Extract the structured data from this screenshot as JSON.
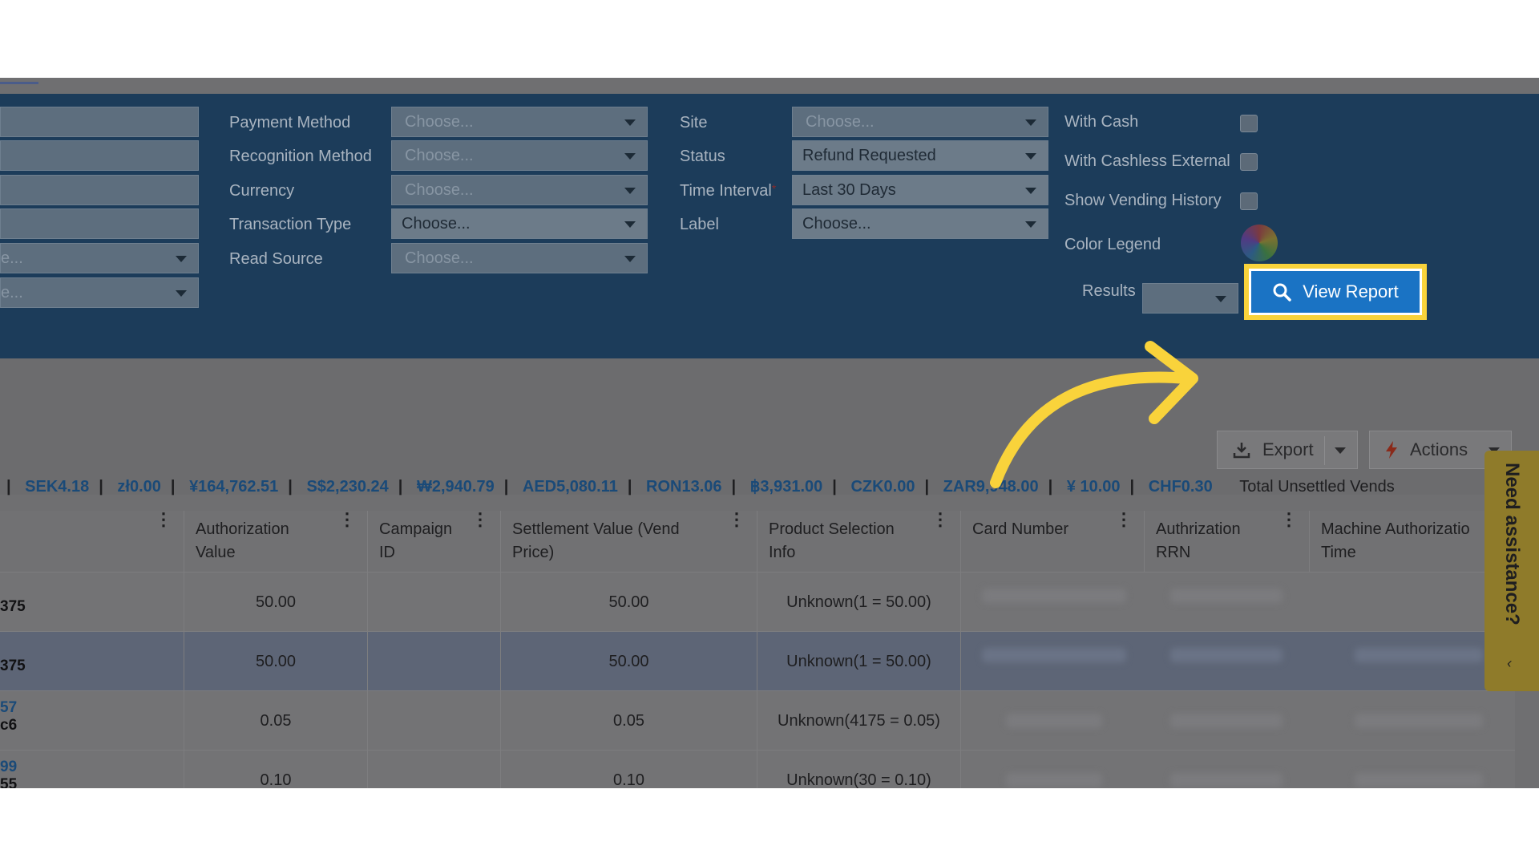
{
  "filters": {
    "col2": [
      {
        "label": "Payment Method",
        "value": "Choose...",
        "filled": false
      },
      {
        "label": "Recognition Method",
        "value": "Choose...",
        "filled": false
      },
      {
        "label": "Currency",
        "value": "Choose...",
        "filled": false
      },
      {
        "label": "Transaction Type",
        "value": "Choose...",
        "filled": true
      },
      {
        "label": "Read Source",
        "value": "Choose...",
        "filled": false
      }
    ],
    "col3": [
      {
        "label": "Site",
        "value": "Choose...",
        "filled": false
      },
      {
        "label": "Status",
        "value": "Refund Requested",
        "filled": true
      },
      {
        "label": "Time Interval",
        "value": "Last 30 Days",
        "filled": true
      },
      {
        "label": "Label",
        "value": "Choose...",
        "filled": true
      }
    ],
    "left_partial_selects": [
      "e...",
      "e..."
    ],
    "checks": [
      {
        "label": "With Cash"
      },
      {
        "label": "With Cashless External"
      },
      {
        "label": "Show Vending History"
      }
    ],
    "color_legend_label": "Color Legend",
    "results_label": "Results",
    "view_report_label": "View Report"
  },
  "toolbar": {
    "export_label": "Export",
    "actions_label": "Actions"
  },
  "currencies": [
    "SEK4.18",
    "zł0.00",
    "¥164,762.51",
    "S$2,230.24",
    "₩2,940.79",
    "AED5,080.11",
    "RON13.06",
    "฿3,931.00",
    "CZK0.00",
    "ZAR9,948.00",
    "¥ 10.00",
    "CHF0.30"
  ],
  "total_unsettled_label": "Total Unsettled Vends",
  "table": {
    "headers": [
      "Authorization Value",
      "Campaign ID",
      "Settlement Value (Vend Price)",
      "Product Selection Info",
      "Card Number",
      "Authrization RRN",
      "Machine Authorization Time"
    ],
    "header_lines": [
      [
        "Authorization",
        "Value"
      ],
      [
        "Campaign",
        "ID"
      ],
      [
        "Settlement Value (Vend",
        "Price)"
      ],
      [
        "Product Selection",
        "Info"
      ],
      [
        "Card Number",
        ""
      ],
      [
        "Authrization",
        "RRN"
      ],
      [
        "Machine Authorizatio",
        "Time"
      ]
    ],
    "rows": [
      {
        "left_top": "375",
        "left_bottom": "",
        "auth": "50.00",
        "campaign": "",
        "settlement": "50.00",
        "product": "Unknown(1 = 50.00)",
        "selected": false
      },
      {
        "left_top": "375",
        "left_bottom": "",
        "auth": "50.00",
        "campaign": "",
        "settlement": "50.00",
        "product": "Unknown(1 = 50.00)",
        "selected": true
      },
      {
        "left_top": "57",
        "left_bottom": "c6",
        "auth": "0.05",
        "campaign": "",
        "settlement": "0.05",
        "product": "Unknown(4175 = 0.05)",
        "selected": false
      },
      {
        "left_top": "99",
        "left_bottom": "55",
        "auth": "0.10",
        "campaign": "",
        "settlement": "0.10",
        "product": "Unknown(30 = 0.10)",
        "selected": false
      }
    ]
  },
  "assistance": {
    "label": "Need assistance?"
  },
  "colors": {
    "panel": "#1c3c5a",
    "highlight": "#f9d33b",
    "primary": "#1a73c4",
    "currency": "#1a4a78"
  }
}
